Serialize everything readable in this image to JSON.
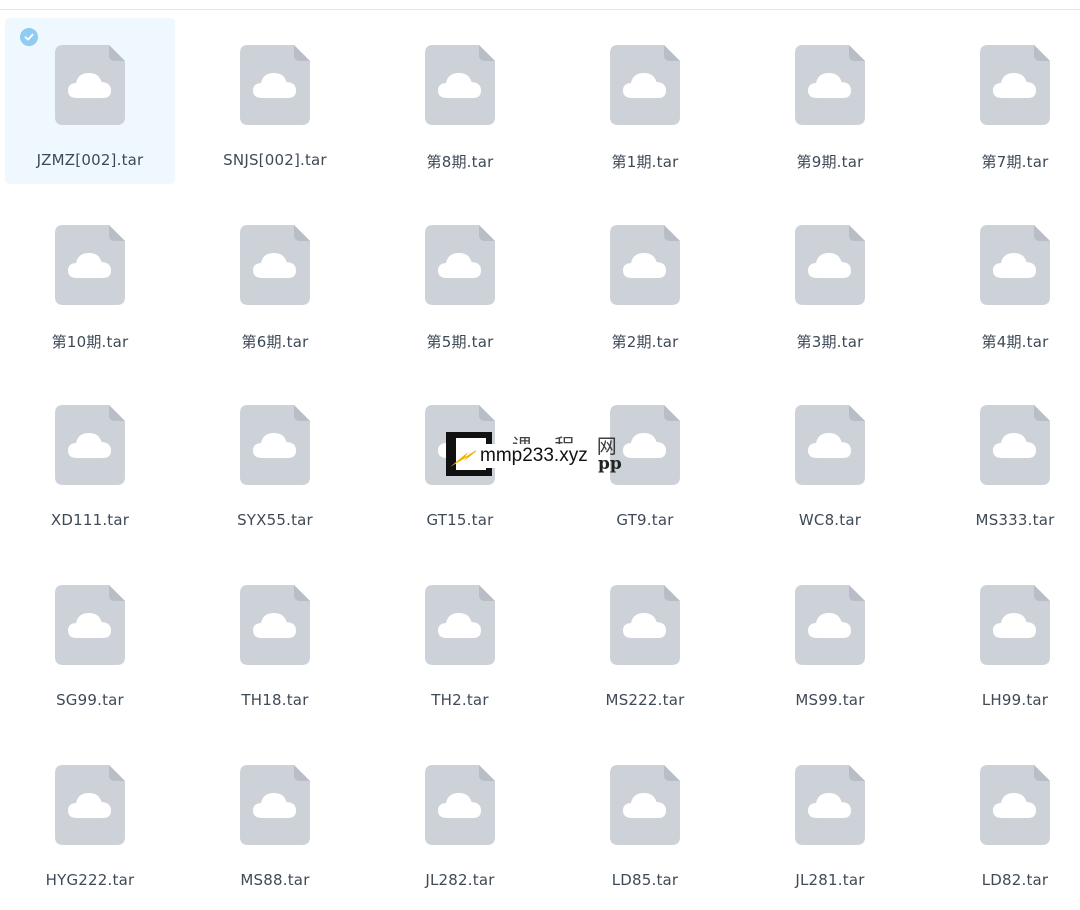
{
  "files": [
    {
      "name": "JZMZ[002].tar",
      "selected": true
    },
    {
      "name": "SNJS[002].tar"
    },
    {
      "name": "第8期.tar"
    },
    {
      "name": "第1期.tar"
    },
    {
      "name": "第9期.tar"
    },
    {
      "name": "第7期.tar"
    },
    {
      "name": "第10期.tar"
    },
    {
      "name": "第6期.tar"
    },
    {
      "name": "第5期.tar"
    },
    {
      "name": "第2期.tar"
    },
    {
      "name": "第3期.tar"
    },
    {
      "name": "第4期.tar"
    },
    {
      "name": "XD111.tar"
    },
    {
      "name": "SYX55.tar"
    },
    {
      "name": "GT15.tar"
    },
    {
      "name": "GT9.tar"
    },
    {
      "name": "WC8.tar"
    },
    {
      "name": "MS333.tar"
    },
    {
      "name": "SG99.tar"
    },
    {
      "name": "TH18.tar"
    },
    {
      "name": "TH2.tar"
    },
    {
      "name": "MS222.tar"
    },
    {
      "name": "MS99.tar"
    },
    {
      "name": "LH99.tar"
    },
    {
      "name": "HYG222.tar"
    },
    {
      "name": "MS88.tar"
    },
    {
      "name": "JL282.tar"
    },
    {
      "name": "LD85.tar"
    },
    {
      "name": "JL281.tar"
    },
    {
      "name": "LD82.tar"
    }
  ],
  "file_icon": "cloud-file-icon",
  "selection_icon": "check-circle-icon",
  "colors": {
    "file_icon_fill": "#cdd1d8",
    "cloud_fill": "#ffffff",
    "selected_bg": "#f0f8ff",
    "check_bg": "#8fcbf2",
    "label_text": "#3f4a57"
  },
  "watermark": {
    "top_text": "课 程 网",
    "site": "mmp233.xyz",
    "suffix": "pp"
  }
}
